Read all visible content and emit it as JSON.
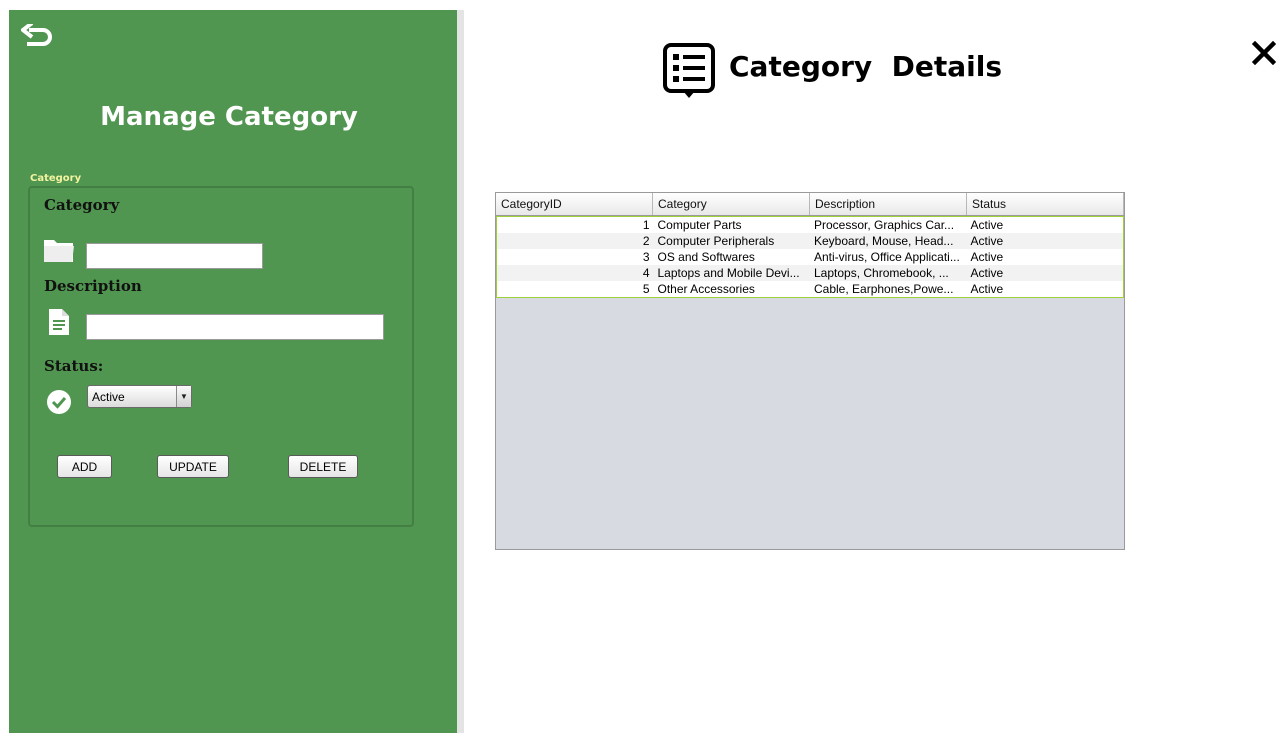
{
  "left_panel": {
    "title": "Manage Category",
    "group_label": "Category",
    "category_label": "Category",
    "category_value": "",
    "description_label": "Description",
    "description_value": "",
    "status_label": "Status:",
    "status_selected": "Active",
    "buttons": {
      "add": "ADD",
      "update": "UPDATE",
      "delete": "DELETE"
    }
  },
  "header": {
    "title": "Category  Details"
  },
  "table": {
    "columns": [
      "CategoryID",
      "Category",
      "Description",
      "Status"
    ],
    "rows": [
      {
        "id": "1",
        "category": "Computer Parts",
        "description": "Processor, Graphics Car...",
        "status": "Active"
      },
      {
        "id": "2",
        "category": "Computer Peripherals",
        "description": "Keyboard, Mouse, Head...",
        "status": "Active"
      },
      {
        "id": "3",
        "category": "OS and Softwares",
        "description": "Anti-virus, Office Applicati...",
        "status": "Active"
      },
      {
        "id": "4",
        "category": "Laptops and Mobile Devi...",
        "description": "Laptops,  Chromebook, ...",
        "status": "Active"
      },
      {
        "id": "5",
        "category": "Other Accessories",
        "description": "Cable, Earphones,Powe...",
        "status": "Active"
      }
    ]
  },
  "icons": {
    "back": "back-arrow-icon",
    "folder": "folder-icon",
    "document": "document-icon",
    "check": "check-circle-icon",
    "list": "list-icon",
    "close": "close-icon"
  },
  "colors": {
    "panel": "#519650",
    "title_text": "#ffffff",
    "group_label": "#f3f3a0",
    "row_border": "#9fd03a"
  }
}
